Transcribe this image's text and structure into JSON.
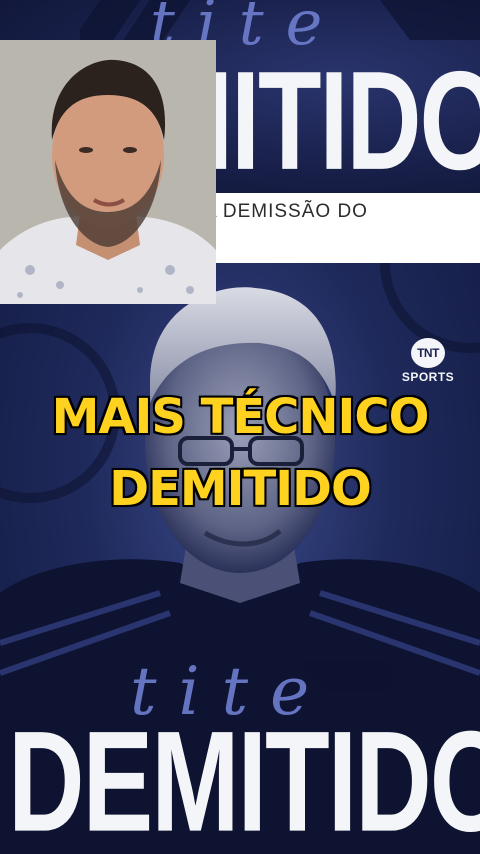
{
  "top_graphic": {
    "script_word": "tite",
    "headline": "DEMITIDO!"
  },
  "caption_strip": {
    "text": "O C      ANUNCIOU A DEMISSÃO DO"
  },
  "watermark": {
    "line1": "TNT",
    "line2": "SPORTS"
  },
  "overlay": {
    "line1": "MAIS TÉCNICO",
    "line2": "DEMITIDO"
  },
  "bottom_graphic": {
    "script_word": "tite",
    "headline": "DEMITIDO!"
  },
  "colors": {
    "background_navy": "#18204a",
    "overlay_text_yellow": "#ffd21f",
    "headline_white": "#f4f5f8",
    "script_blue": "#6f7fd0"
  }
}
